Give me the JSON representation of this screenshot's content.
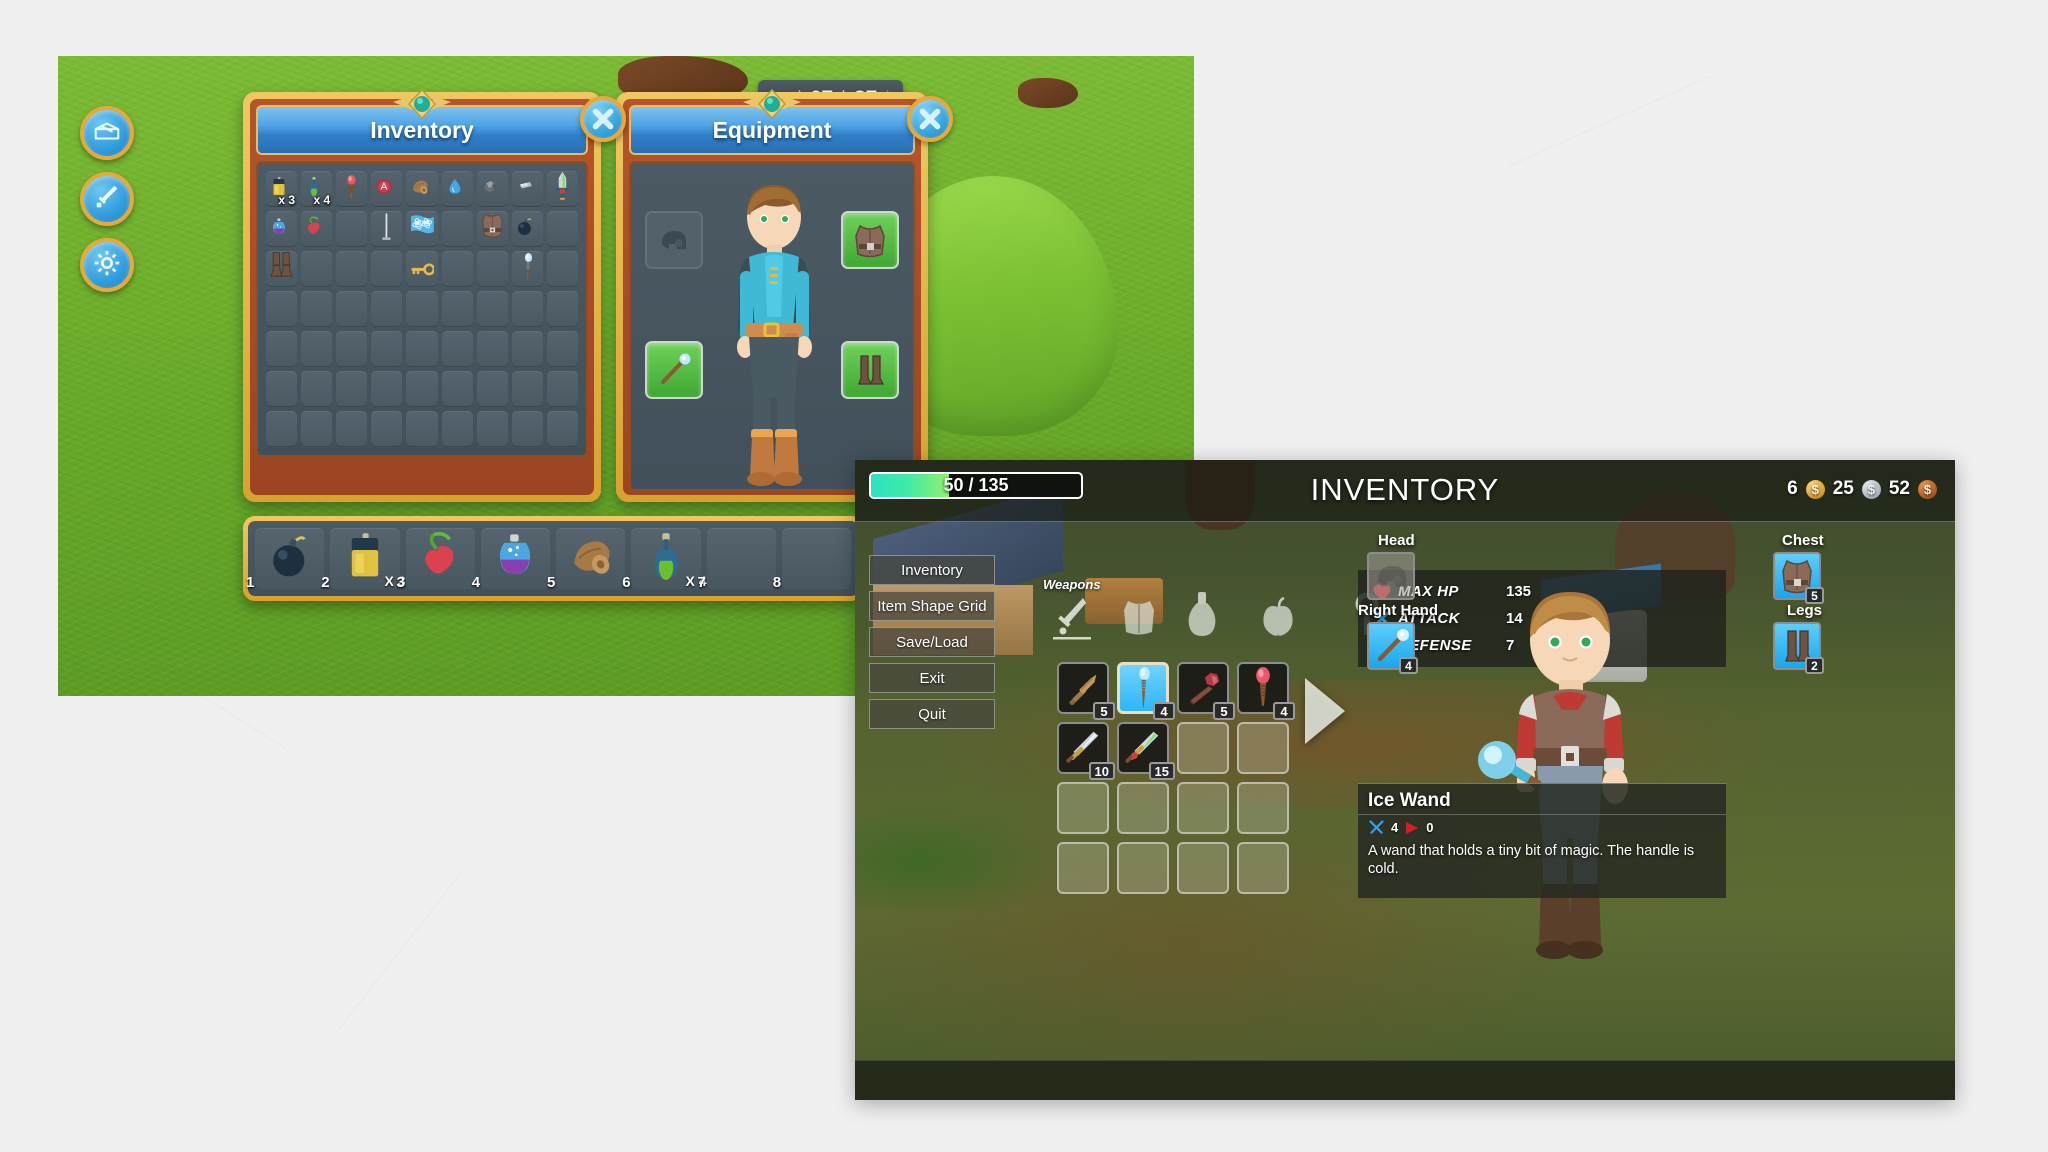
{
  "window1": {
    "side_buttons": [
      {
        "name": "inventory-chest-button",
        "icon": "chest-icon"
      },
      {
        "name": "equipment-sword-button",
        "icon": "sword-icon"
      },
      {
        "name": "settings-gear-button",
        "icon": "gear-icon"
      }
    ],
    "inventory_panel": {
      "title": "Inventory",
      "close_label": "✕",
      "grid": {
        "cols": 9,
        "rows": 7
      },
      "items": [
        {
          "slot": 0,
          "name": "yellow-potion-jar",
          "qty": "x 3"
        },
        {
          "slot": 1,
          "name": "green-potion-bottle",
          "qty": "x 4"
        },
        {
          "slot": 2,
          "name": "red-gem-wand",
          "qty": ""
        },
        {
          "slot": 3,
          "name": "red-seal-badge",
          "qty": ""
        },
        {
          "slot": 4,
          "name": "wood-log",
          "qty": ""
        },
        {
          "slot": 5,
          "name": "water-droplet",
          "qty": ""
        },
        {
          "slot": 6,
          "name": "iron-ore-chunk",
          "qty": ""
        },
        {
          "slot": 7,
          "name": "metal-ingot",
          "qty": ""
        },
        {
          "slot": 8,
          "name": "green-blade-sword",
          "qty": ""
        },
        {
          "slot": 9,
          "name": "blue-flask",
          "qty": ""
        },
        {
          "slot": 10,
          "name": "heart-fruit",
          "qty": ""
        },
        {
          "slot": 12,
          "name": "silver-pole-stand",
          "qty": ""
        },
        {
          "slot": 13,
          "name": "blue-flag-banner",
          "qty": ""
        },
        {
          "slot": 15,
          "name": "leather-chest-armor",
          "qty": ""
        },
        {
          "slot": 16,
          "name": "bomb",
          "qty": ""
        },
        {
          "slot": 18,
          "name": "leather-boots",
          "qty": ""
        },
        {
          "slot": 22,
          "name": "gold-key",
          "qty": ""
        },
        {
          "slot": 25,
          "name": "ice-wand",
          "qty": ""
        }
      ]
    },
    "equipment_panel": {
      "title": "Equipment",
      "close_label": "✕",
      "slots": [
        {
          "name": "head-slot",
          "state": "empty",
          "icon": "helmet-icon"
        },
        {
          "name": "chest-slot",
          "state": "filled",
          "icon": "leather-chest-icon"
        },
        {
          "name": "right-hand-slot",
          "state": "filled",
          "icon": "ice-wand-icon"
        },
        {
          "name": "legs-slot",
          "state": "filled",
          "icon": "boots-icon"
        }
      ]
    },
    "currency": [
      {
        "value": "",
        "coin": "gold"
      },
      {
        "value": "67",
        "coin": "silver"
      },
      {
        "value": "87",
        "coin": "copper"
      }
    ],
    "hotbar": [
      {
        "index": "1",
        "name": "bomb",
        "qty": ""
      },
      {
        "index": "2",
        "name": "yellow-potion-jar",
        "qty": "X 3"
      },
      {
        "index": "3",
        "name": "heart-fruit",
        "qty": ""
      },
      {
        "index": "4",
        "name": "blue-purple-flask",
        "qty": ""
      },
      {
        "index": "5",
        "name": "wood-log",
        "qty": ""
      },
      {
        "index": "6",
        "name": "green-potion-bottle",
        "qty": "X 4"
      },
      {
        "index": "7",
        "name": "",
        "qty": ""
      },
      {
        "index": "8",
        "name": "",
        "qty": ""
      }
    ]
  },
  "window2": {
    "title": "INVENTORY",
    "health": {
      "current": 50,
      "max": 135,
      "text": "50 / 135",
      "percent": 37
    },
    "currency": [
      {
        "value": "6",
        "coin": "gold"
      },
      {
        "value": "25",
        "coin": "silver"
      },
      {
        "value": "52",
        "coin": "copper"
      }
    ],
    "menu": [
      {
        "label": "Inventory",
        "name": "menu-inventory"
      },
      {
        "label": "Item Shape Grid",
        "name": "menu-item-shape-grid"
      },
      {
        "label": "Save/Load",
        "name": "menu-save-load"
      },
      {
        "label": "Exit",
        "name": "menu-exit"
      },
      {
        "label": "Quit",
        "name": "menu-quit"
      }
    ],
    "category_label": "Weapons",
    "categories": [
      {
        "name": "weapons-category-icon",
        "active": true
      },
      {
        "name": "armor-category-icon",
        "active": false
      },
      {
        "name": "potions-category-icon",
        "active": false
      },
      {
        "name": "food-category-icon",
        "active": false
      },
      {
        "name": "keys-category-icon",
        "active": false
      }
    ],
    "grid": {
      "cols": 4,
      "rows": 4,
      "items": [
        {
          "slot": 0,
          "name": "wooden-sword",
          "count": "5",
          "selected": false
        },
        {
          "slot": 1,
          "name": "ice-wand",
          "count": "4",
          "selected": true
        },
        {
          "slot": 2,
          "name": "ruby-wand",
          "count": "5",
          "selected": false
        },
        {
          "slot": 3,
          "name": "red-gem-wand",
          "count": "4",
          "selected": false
        },
        {
          "slot": 4,
          "name": "iron-sword",
          "count": "10",
          "selected": false
        },
        {
          "slot": 5,
          "name": "emerald-sword",
          "count": "15",
          "selected": false
        }
      ]
    },
    "stats": [
      {
        "icon": "heart-icon",
        "label": "MAX HP",
        "value": "135",
        "color": "#e03030"
      },
      {
        "icon": "swords-icon",
        "label": "ATTACK",
        "value": "14",
        "color": "#3a9fe0"
      },
      {
        "icon": "shield-icon",
        "label": "DEFENSE",
        "value": "7",
        "color": "#f0a022"
      }
    ],
    "equipment": [
      {
        "label": "Head",
        "name": "head-slot",
        "state": "empty",
        "count": ""
      },
      {
        "label": "Chest",
        "name": "chest-slot",
        "state": "filled",
        "count": "5"
      },
      {
        "label": "Right Hand",
        "name": "right-hand-slot",
        "state": "filled",
        "count": "4"
      },
      {
        "label": "Legs",
        "name": "legs-slot",
        "state": "filled",
        "count": "2"
      }
    ],
    "tooltip": {
      "name": "Ice Wand",
      "attack": "4",
      "speed": "0",
      "description": "A wand that holds a tiny bit of magic. The handle is cold."
    },
    "next_page_arrow": "▶"
  }
}
